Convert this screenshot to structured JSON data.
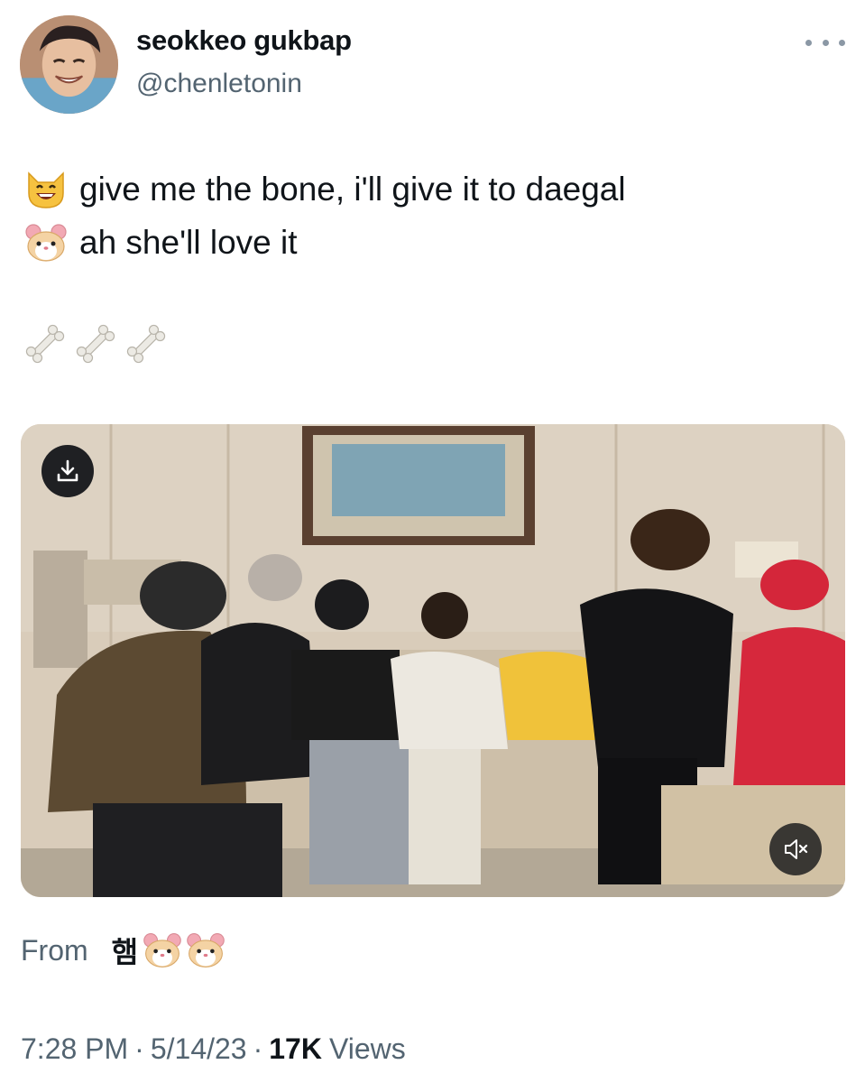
{
  "tweet": {
    "display_name": "seokkeo gukbap",
    "handle": "@chenletonin",
    "more_icon": "more-dots-icon",
    "lines": [
      {
        "emoji": "smiling-cat-face-icon",
        "text": "give me the bone, i'll give it to daegal"
      },
      {
        "emoji": "hamster-face-icon",
        "text": "ah she'll love it"
      }
    ],
    "bones": [
      "bone-icon",
      "bone-icon",
      "bone-icon"
    ]
  },
  "media": {
    "type": "video",
    "download_icon": "download-icon",
    "mute_icon": "muted-speaker-icon"
  },
  "source": {
    "label": "From",
    "name": "햄",
    "emojis": [
      "hamster-face-icon",
      "hamster-face-icon"
    ]
  },
  "meta": {
    "time": "7:28 PM",
    "date": "5/14/23",
    "views_count": "17K",
    "views_label": "Views",
    "separator": "·"
  },
  "colors": {
    "text": "#0f1419",
    "secondary": "#536471",
    "background": "#ffffff"
  }
}
